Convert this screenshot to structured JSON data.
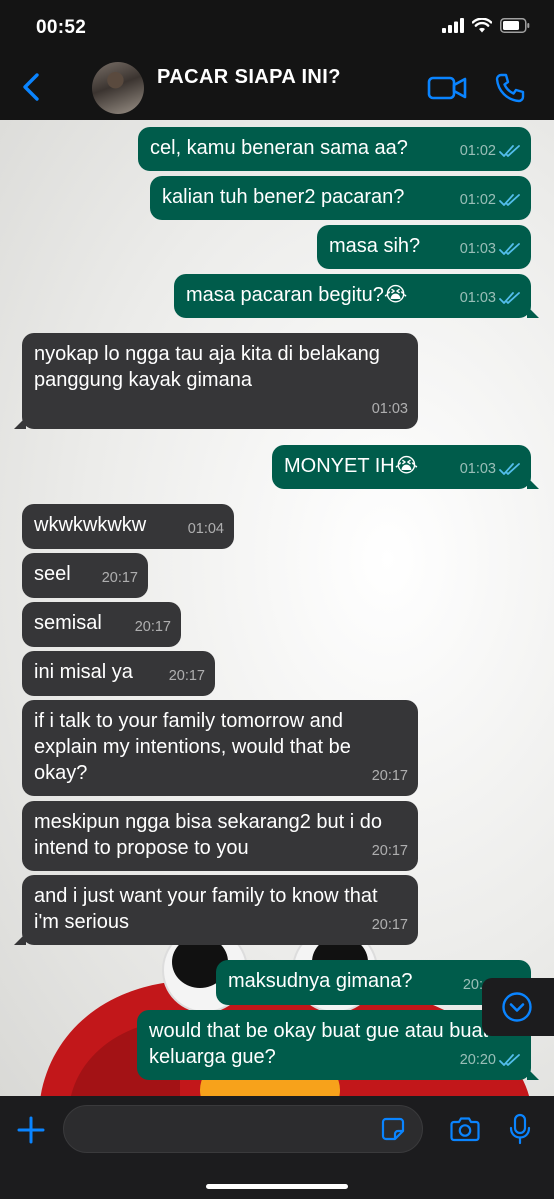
{
  "status_bar": {
    "time": "00:52"
  },
  "header": {
    "contact_name": "PACAR SIAPA INI?"
  },
  "colors": {
    "accent": "#0a84ff",
    "outgoing_bubble": "#005c4b",
    "incoming_bubble": "#363638",
    "read_ticks": "#53bdeb"
  },
  "messages": [
    {
      "direction": "out",
      "text": "cel, kamu beneran sama aa?",
      "time": "01:02"
    },
    {
      "direction": "out",
      "text": "kalian tuh bener2 pacaran?",
      "time": "01:02"
    },
    {
      "direction": "out",
      "text": "masa sih?",
      "time": "01:03"
    },
    {
      "direction": "out",
      "text": "masa pacaran begitu?😭",
      "time": "01:03"
    },
    {
      "direction": "in",
      "text": "nyokap lo ngga tau aja kita di belakang panggung kayak gimana",
      "time": "01:03"
    },
    {
      "direction": "out",
      "text": "MONYET IH😭",
      "time": "01:03"
    },
    {
      "direction": "in",
      "text": "wkwkwkwkw",
      "time": "01:04"
    },
    {
      "direction": "in",
      "text": "seel",
      "time": "20:17"
    },
    {
      "direction": "in",
      "text": "semisal",
      "time": "20:17"
    },
    {
      "direction": "in",
      "text": "ini misal ya",
      "time": "20:17"
    },
    {
      "direction": "in",
      "text": "if i talk to your family tomorrow and explain my intentions, would that be okay?",
      "time": "20:17"
    },
    {
      "direction": "in",
      "text": "meskipun ngga bisa sekarang2 but i do intend to propose to you",
      "time": "20:17"
    },
    {
      "direction": "in",
      "text": "and i just want your family to know that i'm serious",
      "time": "20:17"
    },
    {
      "direction": "out",
      "text": "maksudnya gimana?",
      "time": "20:"
    },
    {
      "direction": "out",
      "text": "would that be okay buat gue atau buat keluarga gue?",
      "time": "20:20"
    }
  ]
}
